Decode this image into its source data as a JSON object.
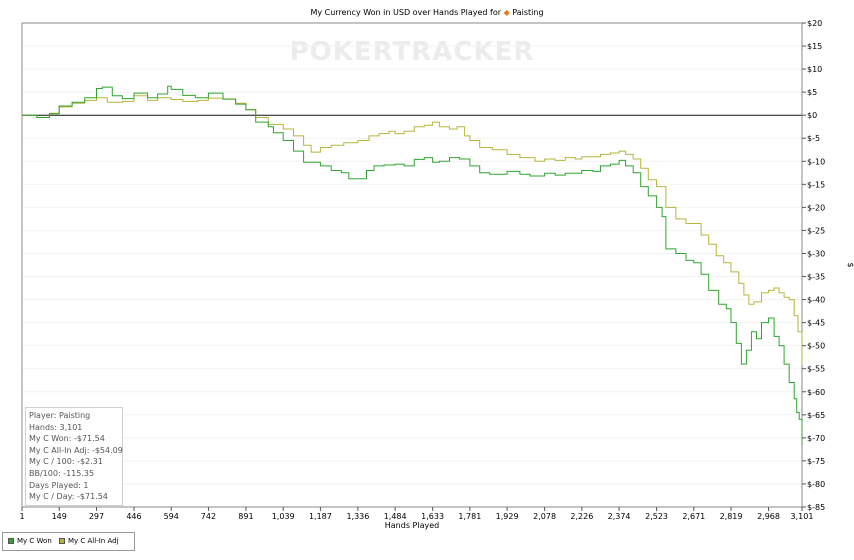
{
  "chart_data": {
    "type": "line",
    "title_prefix": "My Currency Won in USD over Hands Played for",
    "title_player": "Paisting",
    "watermark": "POKERTRACKER",
    "xlabel": "Hands Played",
    "ylabel": "$",
    "xlim": [
      1,
      3101
    ],
    "ylim": [
      -85,
      20
    ],
    "x_ticks": [
      {
        "v": 1,
        "label": "1"
      },
      {
        "v": 149,
        "label": "149"
      },
      {
        "v": 297,
        "label": "297"
      },
      {
        "v": 446,
        "label": "446"
      },
      {
        "v": 594,
        "label": "594"
      },
      {
        "v": 742,
        "label": "742"
      },
      {
        "v": 891,
        "label": "891"
      },
      {
        "v": 1039,
        "label": "1,039"
      },
      {
        "v": 1187,
        "label": "1,187"
      },
      {
        "v": 1336,
        "label": "1,336"
      },
      {
        "v": 1484,
        "label": "1,484"
      },
      {
        "v": 1633,
        "label": "1,633"
      },
      {
        "v": 1781,
        "label": "1,781"
      },
      {
        "v": 1929,
        "label": "1,929"
      },
      {
        "v": 2078,
        "label": "2,078"
      },
      {
        "v": 2226,
        "label": "2,226"
      },
      {
        "v": 2374,
        "label": "2,374"
      },
      {
        "v": 2523,
        "label": "2,523"
      },
      {
        "v": 2671,
        "label": "2,671"
      },
      {
        "v": 2819,
        "label": "2,819"
      },
      {
        "v": 2968,
        "label": "2,968"
      },
      {
        "v": 3101,
        "label": "3,101"
      }
    ],
    "y_ticks": [
      {
        "v": 20,
        "label": "$20"
      },
      {
        "v": 15,
        "label": "$15"
      },
      {
        "v": 10,
        "label": "$10"
      },
      {
        "v": 5,
        "label": "$5"
      },
      {
        "v": 0,
        "label": "$0"
      },
      {
        "v": -5,
        "label": "$-5"
      },
      {
        "v": -10,
        "label": "$-10"
      },
      {
        "v": -15,
        "label": "$-15"
      },
      {
        "v": -20,
        "label": "$-20"
      },
      {
        "v": -25,
        "label": "$-25"
      },
      {
        "v": -30,
        "label": "$-30"
      },
      {
        "v": -35,
        "label": "$-35"
      },
      {
        "v": -40,
        "label": "$-40"
      },
      {
        "v": -45,
        "label": "$-45"
      },
      {
        "v": -50,
        "label": "$-50"
      },
      {
        "v": -55,
        "label": "$-55"
      },
      {
        "v": -60,
        "label": "$-60"
      },
      {
        "v": -65,
        "label": "$-65"
      },
      {
        "v": -70,
        "label": "$-70"
      },
      {
        "v": -75,
        "label": "$-75"
      },
      {
        "v": -80,
        "label": "$-80"
      },
      {
        "v": -85,
        "label": "$-85"
      }
    ],
    "series": [
      {
        "name": "My C Won",
        "color": "#2fa52f",
        "points": [
          [
            1,
            0
          ],
          [
            60,
            -0.5
          ],
          [
            110,
            0.3
          ],
          [
            149,
            2.0
          ],
          [
            200,
            2.8
          ],
          [
            250,
            3.8
          ],
          [
            297,
            5.8
          ],
          [
            320,
            6.1
          ],
          [
            360,
            4.2
          ],
          [
            400,
            3.6
          ],
          [
            446,
            4.8
          ],
          [
            500,
            3.8
          ],
          [
            540,
            4.6
          ],
          [
            580,
            6.3
          ],
          [
            594,
            5.6
          ],
          [
            640,
            4.3
          ],
          [
            690,
            3.8
          ],
          [
            742,
            4.8
          ],
          [
            800,
            3.5
          ],
          [
            850,
            2.4
          ],
          [
            891,
            1.2
          ],
          [
            930,
            -1.5
          ],
          [
            980,
            -2.5
          ],
          [
            1000,
            -3.8
          ],
          [
            1039,
            -5.5
          ],
          [
            1080,
            -7.8
          ],
          [
            1120,
            -10.2
          ],
          [
            1187,
            -11.0
          ],
          [
            1230,
            -12.0
          ],
          [
            1270,
            -12.5
          ],
          [
            1300,
            -13.8
          ],
          [
            1336,
            -13.8
          ],
          [
            1370,
            -12.0
          ],
          [
            1400,
            -11.0
          ],
          [
            1440,
            -10.8
          ],
          [
            1484,
            -10.6
          ],
          [
            1520,
            -11.0
          ],
          [
            1560,
            -9.6
          ],
          [
            1600,
            -9.2
          ],
          [
            1633,
            -10.2
          ],
          [
            1660,
            -10.0
          ],
          [
            1700,
            -9.2
          ],
          [
            1740,
            -9.5
          ],
          [
            1781,
            -11.0
          ],
          [
            1820,
            -12.5
          ],
          [
            1860,
            -12.8
          ],
          [
            1929,
            -12.2
          ],
          [
            1980,
            -12.8
          ],
          [
            2020,
            -13.2
          ],
          [
            2078,
            -12.6
          ],
          [
            2120,
            -13.0
          ],
          [
            2160,
            -12.6
          ],
          [
            2226,
            -12.0
          ],
          [
            2270,
            -12.2
          ],
          [
            2300,
            -11.0
          ],
          [
            2340,
            -10.6
          ],
          [
            2374,
            -9.8
          ],
          [
            2400,
            -11.0
          ],
          [
            2430,
            -12.5
          ],
          [
            2460,
            -15.5
          ],
          [
            2490,
            -17.5
          ],
          [
            2523,
            -20.0
          ],
          [
            2545,
            -22.0
          ],
          [
            2560,
            -29.0
          ],
          [
            2600,
            -30.0
          ],
          [
            2640,
            -31.5
          ],
          [
            2671,
            -32.0
          ],
          [
            2700,
            -34.5
          ],
          [
            2730,
            -38.0
          ],
          [
            2770,
            -41.0
          ],
          [
            2800,
            -42.0
          ],
          [
            2819,
            -45.0
          ],
          [
            2840,
            -49.5
          ],
          [
            2860,
            -54.0
          ],
          [
            2880,
            -51.0
          ],
          [
            2900,
            -47.0
          ],
          [
            2920,
            -48.5
          ],
          [
            2940,
            -45.0
          ],
          [
            2968,
            -44.0
          ],
          [
            2990,
            -48.0
          ],
          [
            3010,
            -50.0
          ],
          [
            3030,
            -54.0
          ],
          [
            3050,
            -58.0
          ],
          [
            3070,
            -61.5
          ],
          [
            3080,
            -64.5
          ],
          [
            3090,
            -66.0
          ],
          [
            3101,
            -71.54
          ]
        ]
      },
      {
        "name": "My C All-In Adj",
        "color": "#b5b53c",
        "points": [
          [
            1,
            0
          ],
          [
            60,
            -0.5
          ],
          [
            110,
            0.4
          ],
          [
            149,
            1.8
          ],
          [
            200,
            2.6
          ],
          [
            250,
            3.2
          ],
          [
            297,
            3.8
          ],
          [
            340,
            2.8
          ],
          [
            400,
            3.0
          ],
          [
            446,
            4.2
          ],
          [
            500,
            3.2
          ],
          [
            540,
            3.8
          ],
          [
            594,
            3.4
          ],
          [
            640,
            3.0
          ],
          [
            700,
            3.2
          ],
          [
            742,
            3.7
          ],
          [
            800,
            3.5
          ],
          [
            850,
            2.6
          ],
          [
            891,
            1.2
          ],
          [
            930,
            -0.5
          ],
          [
            980,
            -2.0
          ],
          [
            1039,
            -3.0
          ],
          [
            1080,
            -4.5
          ],
          [
            1120,
            -6.5
          ],
          [
            1150,
            -8.0
          ],
          [
            1187,
            -7.0
          ],
          [
            1230,
            -6.5
          ],
          [
            1280,
            -6.0
          ],
          [
            1336,
            -5.5
          ],
          [
            1380,
            -4.5
          ],
          [
            1420,
            -4.0
          ],
          [
            1460,
            -3.5
          ],
          [
            1484,
            -4.0
          ],
          [
            1520,
            -3.5
          ],
          [
            1560,
            -2.5
          ],
          [
            1600,
            -2.2
          ],
          [
            1633,
            -1.5
          ],
          [
            1660,
            -2.5
          ],
          [
            1700,
            -3.0
          ],
          [
            1730,
            -2.5
          ],
          [
            1760,
            -4.5
          ],
          [
            1781,
            -5.5
          ],
          [
            1820,
            -7.0
          ],
          [
            1870,
            -7.5
          ],
          [
            1929,
            -8.5
          ],
          [
            1980,
            -9.2
          ],
          [
            2040,
            -10.0
          ],
          [
            2078,
            -9.5
          ],
          [
            2120,
            -9.8
          ],
          [
            2160,
            -9.2
          ],
          [
            2200,
            -9.5
          ],
          [
            2226,
            -9.0
          ],
          [
            2270,
            -9.0
          ],
          [
            2300,
            -8.5
          ],
          [
            2340,
            -8.2
          ],
          [
            2374,
            -7.8
          ],
          [
            2400,
            -8.5
          ],
          [
            2430,
            -9.5
          ],
          [
            2460,
            -11.5
          ],
          [
            2490,
            -14.0
          ],
          [
            2523,
            -15.5
          ],
          [
            2560,
            -20.0
          ],
          [
            2600,
            -22.5
          ],
          [
            2640,
            -23.5
          ],
          [
            2671,
            -23.5
          ],
          [
            2700,
            -26.0
          ],
          [
            2730,
            -28.0
          ],
          [
            2760,
            -30.5
          ],
          [
            2790,
            -32.0
          ],
          [
            2819,
            -34.0
          ],
          [
            2850,
            -36.5
          ],
          [
            2870,
            -39.0
          ],
          [
            2890,
            -41.0
          ],
          [
            2910,
            -40.5
          ],
          [
            2940,
            -38.5
          ],
          [
            2968,
            -38.0
          ],
          [
            2990,
            -37.5
          ],
          [
            3010,
            -38.5
          ],
          [
            3030,
            -39.5
          ],
          [
            3050,
            -40.0
          ],
          [
            3070,
            -43.5
          ],
          [
            3085,
            -47.0
          ],
          [
            3101,
            -54.09
          ]
        ]
      }
    ]
  },
  "stats": {
    "player": "Player: Paisting",
    "hands": "Hands: 3,101",
    "won": "My C Won: -$71.54",
    "allin": "My C All-In Adj: -$54.09",
    "per100": "My C / 100: -$2.31",
    "bb100": "BB/100: -115.35",
    "days": "Days Played: 1",
    "perday": "My C / Day: -$71.54"
  },
  "legend": {
    "won_label": "My C Won",
    "allin_label": "My C All-In Adj"
  }
}
